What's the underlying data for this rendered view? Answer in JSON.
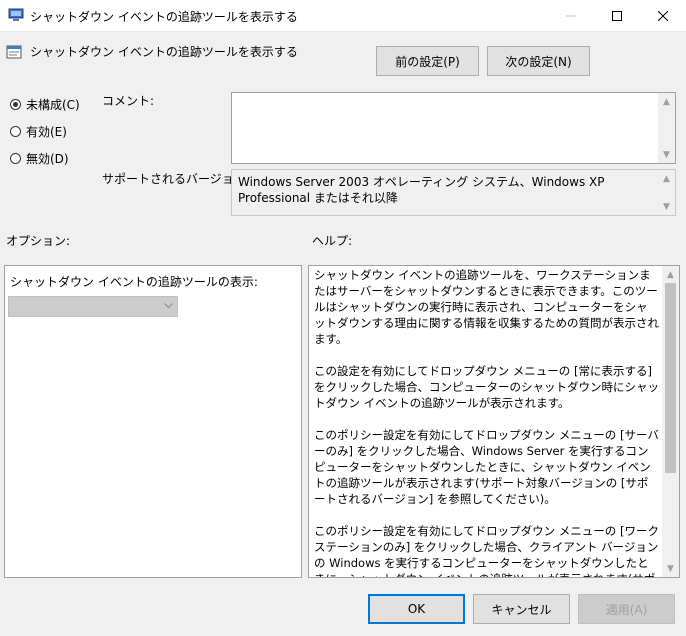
{
  "window": {
    "title": "シャットダウン イベントの追跡ツールを表示する",
    "minimize": "—",
    "maximize": "☐",
    "close": "✕"
  },
  "policy": {
    "title": "シャットダウン イベントの追跡ツールを表示する",
    "prev_button": "前の設定(P)",
    "next_button": "次の設定(N)"
  },
  "state": {
    "not_configured": "未構成(C)",
    "enabled": "有効(E)",
    "disabled": "無効(D)",
    "selected": "not_configured"
  },
  "comment": {
    "label": "コメント:",
    "value": ""
  },
  "supported": {
    "label": "サポートされるバージョン:",
    "value": "Windows Server 2003 オペレーティング システム、Windows XP Professional またはそれ以降"
  },
  "options": {
    "header": "オプション:",
    "dropdown_label": "シャットダウン イベントの追跡ツールの表示:",
    "dropdown_value": ""
  },
  "help": {
    "header": "ヘルプ:",
    "text": "シャットダウン イベントの追跡ツールを、ワークステーションまたはサーバーをシャットダウンするときに表示できます。このツールはシャットダウンの実行時に表示され、コンピューターをシャットダウンする理由に関する情報を収集するための質問が表示されます。\n\nこの設定を有効にしてドロップダウン メニューの [常に表示する] をクリックした場合、コンピューターのシャットダウン時にシャットダウン イベントの追跡ツールが表示されます。\n\nこのポリシー設定を有効にしてドロップダウン メニューの [サーバーのみ] をクリックした場合、Windows Server を実行するコンピューターをシャットダウンしたときに、シャットダウン イベントの追跡ツールが表示されます(サポート対象バージョンの [サポートされるバージョン] を参照してください)。\n\nこのポリシー設定を有効にしてドロップダウン メニューの [ワークステーションのみ] をクリックした場合、クライアント バージョンの Windows を実行するコンピューターをシャットダウンしたときに、シャットダウン イベントの追跡ツールが表示されます(サポート対象バージョンの [サポートされるバージョン] を参照してください)。\n\nこのポリシー設定を無効にした場合は、コンピューターをシャットダウンしても"
  },
  "footer": {
    "ok": "OK",
    "cancel": "キャンセル",
    "apply": "適用(A)"
  }
}
